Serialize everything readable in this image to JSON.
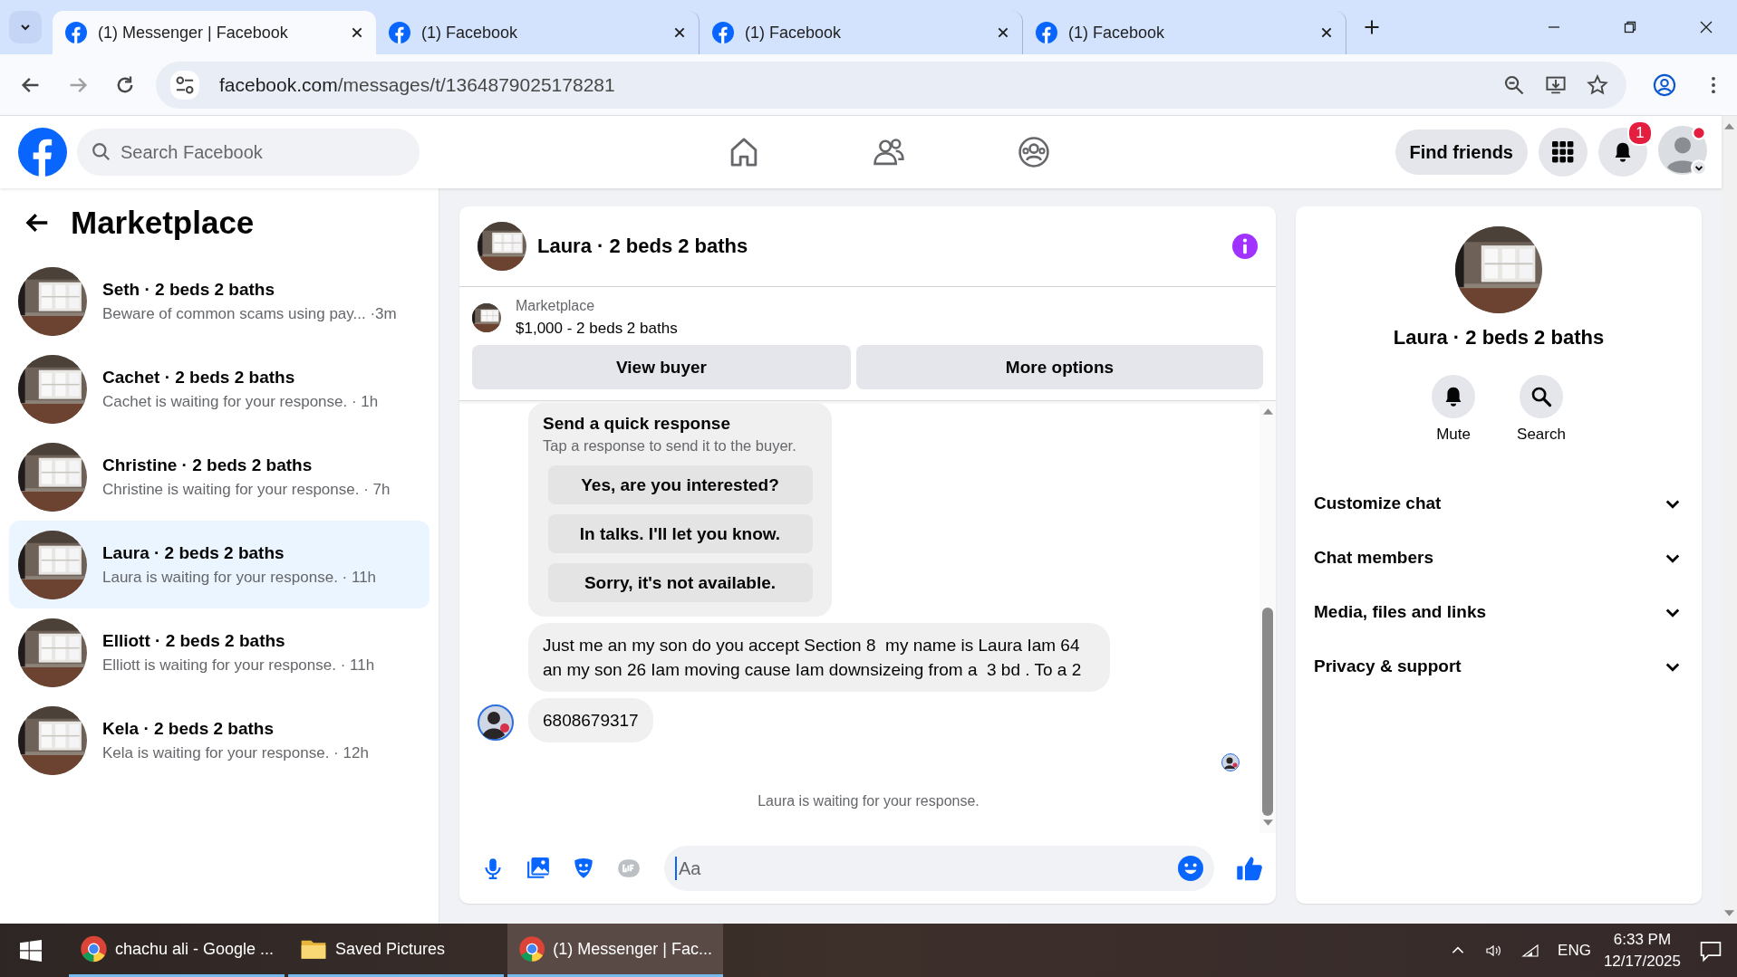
{
  "browser": {
    "tabs": [
      {
        "title": "(1) Messenger | Facebook",
        "selected": true
      },
      {
        "title": "(1) Facebook",
        "selected": false
      },
      {
        "title": "(1) Facebook",
        "selected": false
      },
      {
        "title": "(1) Facebook",
        "selected": false
      }
    ],
    "url_host": "facebook.com",
    "url_path": "/messages/t/1364879025178281"
  },
  "header": {
    "search_placeholder": "Search Facebook",
    "find_friends": "Find friends",
    "notification_count": "1"
  },
  "sidebar": {
    "title": "Marketplace",
    "conversations": [
      {
        "name": "Seth · 2 beds 2 baths",
        "preview": "Beware of common scams using pay...",
        "time": "·3m",
        "selected": false
      },
      {
        "name": "Cachet · 2 beds 2 baths",
        "preview": "Cachet is waiting for your response.",
        "time": "· 1h",
        "selected": false
      },
      {
        "name": "Christine · 2 beds 2 baths",
        "preview": "Christine is waiting for your response.",
        "time": "· 7h",
        "selected": false
      },
      {
        "name": "Laura · 2 beds 2 baths",
        "preview": "Laura is waiting for your response.",
        "time": "· 11h",
        "selected": true
      },
      {
        "name": "Elliott · 2 beds 2 baths",
        "preview": "Elliott is waiting for your response.",
        "time": "· 11h",
        "selected": false
      },
      {
        "name": "Kela · 2 beds 2 baths",
        "preview": "Kela is waiting for your response.",
        "time": "· 12h",
        "selected": false
      }
    ]
  },
  "chat": {
    "title": "Laura · 2 beds 2 baths",
    "listing": {
      "label": "Marketplace",
      "price": "$1,000 - 2 beds 2 baths"
    },
    "actions": [
      "View buyer",
      "More options"
    ],
    "quick_response": {
      "title": "Send a quick response",
      "subtitle": "Tap a response to send it to the buyer.",
      "options": [
        "Yes, are you interested?",
        "In talks. I'll let you know.",
        "Sorry, it's not available."
      ]
    },
    "messages": [
      {
        "text": "Just me an my son do you accept Section 8  my name is Laura Iam 64 an my son 26 Iam moving cause Iam downsizeing from a  3 bd . To a 2",
        "avatar": false
      },
      {
        "text": "6808679317",
        "avatar": true
      }
    ],
    "status": "Laura is waiting for your response.",
    "composer": {
      "placeholder": "Aa"
    }
  },
  "details": {
    "title": "Laura · 2 beds 2 baths",
    "actions": [
      {
        "kind": "mute",
        "label": "Mute"
      },
      {
        "kind": "search",
        "label": "Search"
      }
    ],
    "sections": [
      {
        "label": "Customize chat",
        "expanded": false
      },
      {
        "label": "Chat members",
        "expanded": false
      },
      {
        "label": "Media, files and links",
        "expanded": false
      },
      {
        "label": "Privacy & support",
        "expanded": false
      }
    ]
  },
  "taskbar": {
    "apps": [
      {
        "kind": "chrome",
        "label": "chachu ali - Google ...",
        "selected": false
      },
      {
        "kind": "folder",
        "label": "Saved Pictures",
        "selected": false
      },
      {
        "kind": "chrome",
        "label": "(1) Messenger | Fac...",
        "selected": true
      }
    ],
    "language": "ENG",
    "time": "6:33 PM",
    "date": "12/17/2025"
  }
}
